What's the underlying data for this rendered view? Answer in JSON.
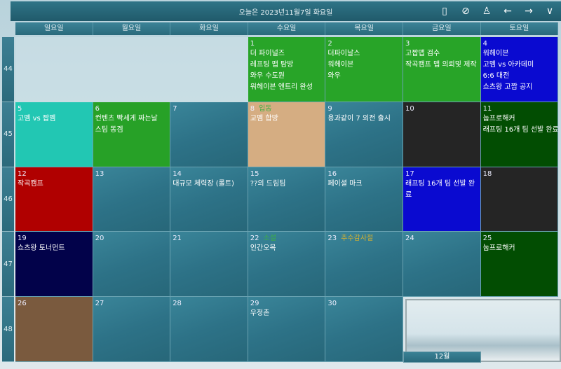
{
  "header": {
    "title": "오늘은 2023년11월7일 화요일",
    "tools": [
      {
        "name": "phone-icon",
        "glyph": "▯"
      },
      {
        "name": "cloud-check-icon",
        "glyph": "⊘"
      },
      {
        "name": "user-icon",
        "glyph": "♙"
      },
      {
        "name": "arrow-left-icon",
        "glyph": "←"
      },
      {
        "name": "arrow-right-icon",
        "glyph": "→"
      },
      {
        "name": "chevron-down-icon",
        "glyph": "∨"
      }
    ]
  },
  "weekdays": [
    "일요일",
    "월요일",
    "화요일",
    "수요일",
    "목요일",
    "금요일",
    "토요일"
  ],
  "weeks": [
    "44",
    "45",
    "46",
    "47",
    "48"
  ],
  "month_tab": "12월",
  "cells": [
    {
      "empty": true
    },
    {
      "empty": true
    },
    {
      "empty": true
    },
    {
      "day": "1",
      "color": "#28a428",
      "events": [
        "더 파이널즈",
        "레프팅 맵 탐방",
        "와우 수도원",
        "워헤이븐 엔트리 완성"
      ]
    },
    {
      "day": "2",
      "color": "#28a428",
      "events": [
        "더파이날스",
        "워헤이븐",
        "와우"
      ]
    },
    {
      "day": "3",
      "color": "#28a428",
      "events": [
        "고짭맵 검수",
        "작곡캠프 맵 의뢰및 제작"
      ]
    },
    {
      "day": "4",
      "color": "#0a0ad0",
      "events": [
        "워헤이븐",
        "고멤 vs 아카데미",
        "6:6 대전",
        "쇼츠왕 고짭 공지"
      ]
    },
    {
      "day": "5",
      "color": "#22c7b3",
      "events": [
        "고멤 vs 짭멤"
      ]
    },
    {
      "day": "6",
      "color": "#27a127",
      "events": [
        "컨텐츠 빡세게 짜는날",
        "스팀 똥겜"
      ]
    },
    {
      "day": "7",
      "events": []
    },
    {
      "day": "8",
      "holiday": "입동",
      "holiday_color": "#3cb043",
      "color": "#d5ad82",
      "events": [
        "교멤 합방"
      ]
    },
    {
      "day": "9",
      "events": [
        "용과같이 7 외전 출시"
      ]
    },
    {
      "day": "10",
      "color": "#252525",
      "events": []
    },
    {
      "day": "11",
      "color": "#024d02",
      "events": [
        "눕프로해커",
        "래프팅 16개 팀 선발 완료"
      ]
    },
    {
      "day": "12",
      "color": "#b00000",
      "events": [
        "작곡캠프"
      ]
    },
    {
      "day": "13",
      "events": []
    },
    {
      "day": "14",
      "events": [
        "대규모 체력장 (롤트)"
      ]
    },
    {
      "day": "15",
      "events": [
        "??의 드림팀"
      ]
    },
    {
      "day": "16",
      "events": [
        "페이셜 마크"
      ]
    },
    {
      "day": "17",
      "color": "#0a0ad0",
      "events": [
        "래프팅 16개 팀 선발 완",
        "료"
      ]
    },
    {
      "day": "18",
      "color": "#252525",
      "events": []
    },
    {
      "day": "19",
      "color": "#02024a",
      "events": [
        "쇼츠왕 토너먼트"
      ]
    },
    {
      "day": "20",
      "events": []
    },
    {
      "day": "21",
      "events": []
    },
    {
      "day": "22",
      "holiday": "소설",
      "holiday_color": "#3cb043",
      "events": [
        "인간오목"
      ]
    },
    {
      "day": "23",
      "holiday": "추수감사절",
      "holiday_color": "#d4b030",
      "events": []
    },
    {
      "day": "24",
      "events": []
    },
    {
      "day": "25",
      "color": "#024d02",
      "events": [
        "눕프로해커"
      ]
    },
    {
      "day": "26",
      "color": "#7a5a3e",
      "events": []
    },
    {
      "day": "27",
      "events": []
    },
    {
      "day": "28",
      "events": []
    },
    {
      "day": "29",
      "events": [
        "우정촌"
      ]
    },
    {
      "day": "30",
      "events": []
    }
  ]
}
